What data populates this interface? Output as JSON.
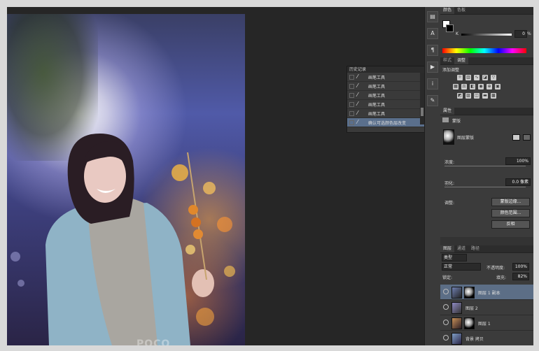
{
  "history": {
    "title": "历史记录",
    "items": [
      "画笔工具",
      "画笔工具",
      "画笔工具",
      "画笔工具",
      "画笔工具",
      "确认可选颜色层改变"
    ],
    "selected_index": 5
  },
  "color_panel": {
    "tabs": [
      "颜色",
      "色板"
    ],
    "k_label": "K",
    "k_value": "0",
    "k_unit": "%"
  },
  "adjustments_panel": {
    "tabs": [
      "样式",
      "调整"
    ],
    "title": "添加调整"
  },
  "properties_panel": {
    "tab": "属性",
    "mode": "蒙版",
    "mask_label": "图层蒙版",
    "density_label": "浓度:",
    "density_value": "100%",
    "feather_label": "羽化:",
    "feather_value": "0.0 像素",
    "refine_label": "调整:",
    "btn_mask_edge": "蒙版边缘...",
    "btn_color_range": "颜色范围...",
    "btn_invert": "反相"
  },
  "layers_panel": {
    "tabs": [
      "图层",
      "通道",
      "路径"
    ],
    "filter_label": "类型",
    "blend_mode": "正常",
    "opacity_label": "不透明度:",
    "opacity_value": "100%",
    "lock_label": "锁定:",
    "fill_label": "填充:",
    "fill_value": "82%",
    "layers": [
      {
        "name": "图层 1 副本",
        "selected": true
      },
      {
        "name": "图层 2",
        "selected": false
      },
      {
        "name": "图层 1",
        "selected": false
      },
      {
        "name": "背景 拷贝",
        "selected": false
      }
    ]
  },
  "watermark": "POCO",
  "colors": {
    "selection": "#5c6e86",
    "panel_bg": "#3b3b3b",
    "workspace_bg": "#262626"
  }
}
